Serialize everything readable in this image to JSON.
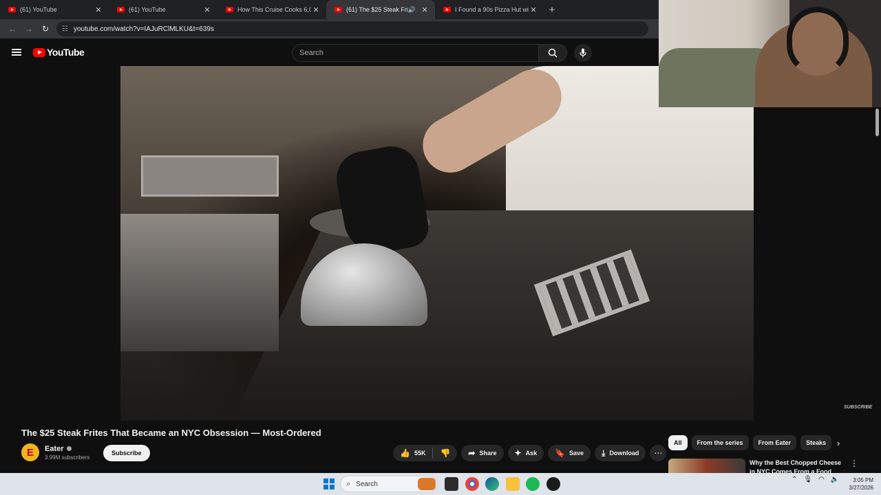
{
  "browser": {
    "tabs": [
      {
        "title": "(61) YouTube",
        "active": false,
        "audio": false
      },
      {
        "title": "(61) YouTube",
        "active": false,
        "audio": false
      },
      {
        "title": "How This Cruise Cooks 6,000 Lb",
        "active": false,
        "audio": false
      },
      {
        "title": "(61) The $25 Steak Frites Th",
        "active": true,
        "audio": true
      },
      {
        "title": "I Found a 90s Pizza Hut with an",
        "active": false,
        "audio": false
      }
    ],
    "url": "youtube.com/watch?v=IAJuRClMLKU&t=639s"
  },
  "youtube": {
    "logo_text": "YouTube",
    "search_placeholder": "Search",
    "video_overlay_label": "SUBSCRIBE",
    "video": {
      "title": "The $25 Steak Frites That Became an NYC Obsession — Most-Ordered",
      "channel_initial": "E",
      "channel_name": "Eater",
      "subscribers": "3.99M subscribers",
      "subscribe_label": "Subscribe",
      "like_count": "55K",
      "share_label": "Share",
      "ask_label": "Ask",
      "save_label": "Save",
      "download_label": "Download"
    },
    "chips": [
      "All",
      "From the series",
      "From Eater",
      "Steaks"
    ],
    "recommendation": {
      "title": "Why the Best Chopped Cheese in NYC Comes From a Food"
    }
  },
  "taskbar": {
    "search_label": "Search",
    "time": "3:05 PM",
    "date": "3/27/2026"
  },
  "colors": {
    "youtube_red": "#ff0000",
    "background": "#0f0f0f",
    "taskbar": "#dfe3ea"
  }
}
